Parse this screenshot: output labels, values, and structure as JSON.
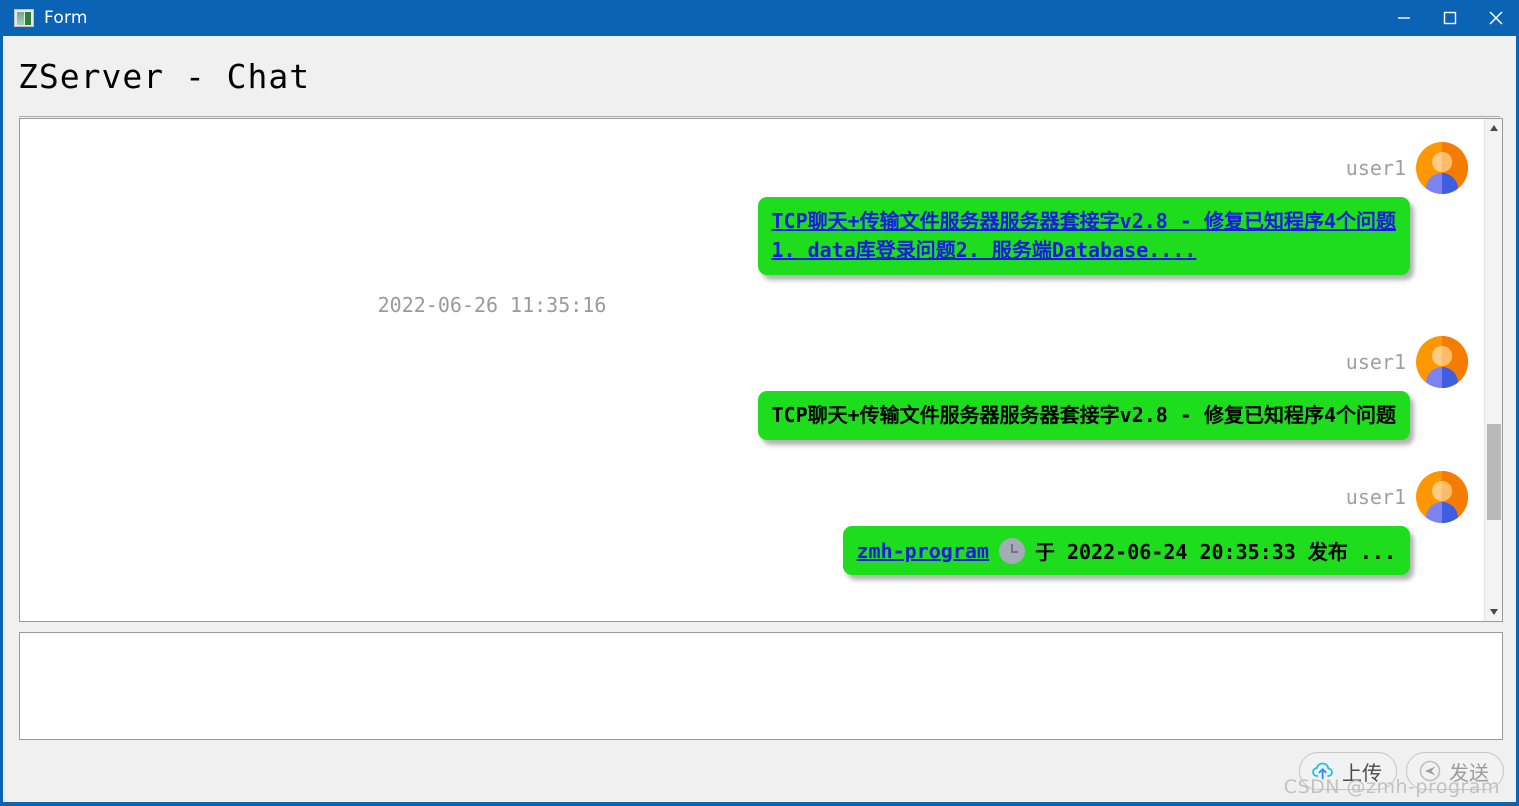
{
  "window": {
    "title": "Form",
    "icon": "form-app-icon",
    "titlebar_color": "#0b63b5",
    "controls": [
      {
        "name": "minimize",
        "glyph": "minimize-icon"
      },
      {
        "name": "maximize",
        "glyph": "maximize-icon"
      },
      {
        "name": "close",
        "glyph": "close-icon"
      }
    ]
  },
  "header": {
    "title": "ZServer - Chat"
  },
  "chat": {
    "bubble_color": "#1ddd1d",
    "link_color": "#1a1ae0",
    "messages": [
      {
        "user": "user1",
        "type": "link",
        "lines": [
          "TCP聊天+传输文件服务器服务器套接字v2.8 - 修复已知程序4个问题",
          "1. data库登录问题2. 服务端Database...."
        ],
        "timestamp": "2022-06-26 11:35:16"
      },
      {
        "user": "user1",
        "type": "plain",
        "lines": [
          "TCP聊天+传输文件服务器服务器套接字v2.8 - 修复已知程序4个问题"
        ],
        "timestamp": ""
      },
      {
        "user": "user1",
        "type": "inline",
        "author_link": "zmh-program",
        "icon": "clock-icon",
        "rest": "于 2022-06-24 20:35:33 发布 ...",
        "timestamp": ""
      }
    ]
  },
  "scrollbar": {
    "up_arrow": "caret-up-icon",
    "down_arrow": "caret-down-icon"
  },
  "composer": {
    "value": "",
    "placeholder": ""
  },
  "toolbar": {
    "upload_label": "上传",
    "upload_icon": "cloud-upload-icon",
    "send_label": "发送",
    "send_icon": "paper-plane-icon",
    "send_disabled": true
  },
  "watermark": {
    "text": "CSDN @zmh-program"
  }
}
